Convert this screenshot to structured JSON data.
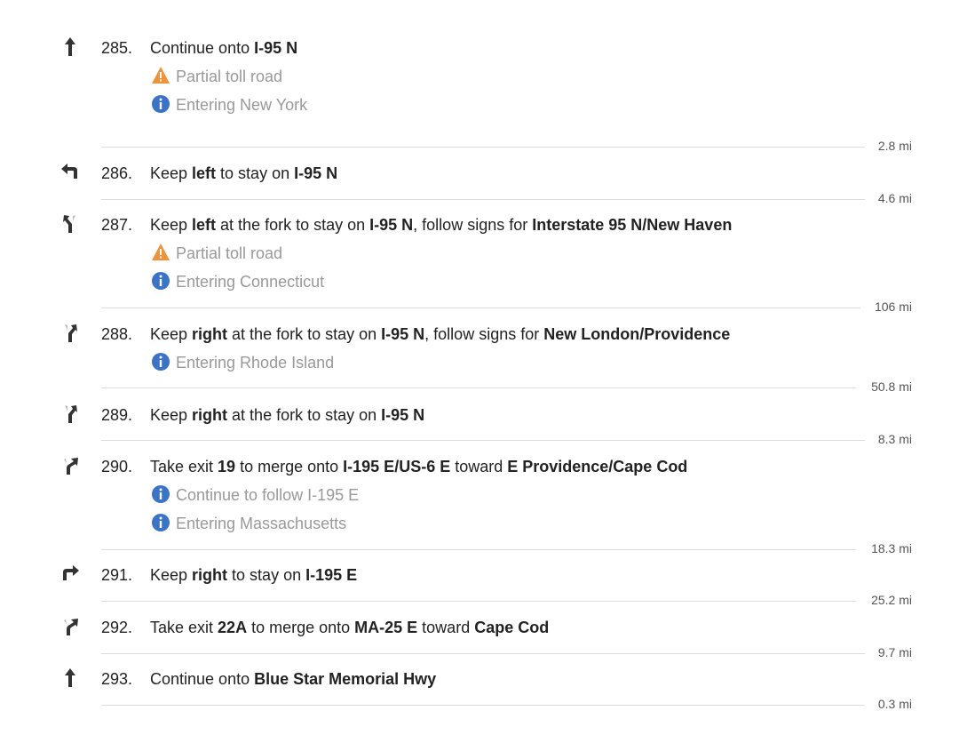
{
  "steps": [
    {
      "num": "285.",
      "icon": "arrow-straight-icon",
      "parts": [
        [
          "Continue onto ",
          false
        ],
        [
          "I-95 N",
          true
        ]
      ],
      "notes": [
        {
          "type": "warning",
          "text": "Partial toll road"
        },
        {
          "type": "info",
          "text": "Entering New York"
        }
      ],
      "distance": "2.8 mi"
    },
    {
      "num": "286.",
      "icon": "keep-left-icon",
      "parts": [
        [
          "Keep ",
          false
        ],
        [
          "left",
          true
        ],
        [
          " to stay on ",
          false
        ],
        [
          "I-95 N",
          true
        ]
      ],
      "notes": [],
      "distance": "4.6 mi"
    },
    {
      "num": "287.",
      "icon": "fork-left-icon",
      "parts": [
        [
          "Keep ",
          false
        ],
        [
          "left",
          true
        ],
        [
          " at the fork to stay on ",
          false
        ],
        [
          "I-95 N",
          true
        ],
        [
          ", follow signs for ",
          false
        ],
        [
          "Interstate 95 N/New Haven",
          true
        ]
      ],
      "notes": [
        {
          "type": "warning",
          "text": "Partial toll road"
        },
        {
          "type": "info",
          "text": "Entering Connecticut"
        }
      ],
      "distance": "106 mi"
    },
    {
      "num": "288.",
      "icon": "fork-right-icon",
      "parts": [
        [
          "Keep ",
          false
        ],
        [
          "right",
          true
        ],
        [
          " at the fork to stay on ",
          false
        ],
        [
          "I-95 N",
          true
        ],
        [
          ", follow signs for ",
          false
        ],
        [
          "New London/Providence",
          true
        ]
      ],
      "notes": [
        {
          "type": "info",
          "text": "Entering Rhode Island"
        }
      ],
      "distance": "50.8 mi"
    },
    {
      "num": "289.",
      "icon": "fork-right-icon",
      "parts": [
        [
          "Keep ",
          false
        ],
        [
          "right",
          true
        ],
        [
          " at the fork to stay on ",
          false
        ],
        [
          "I-95 N",
          true
        ]
      ],
      "notes": [],
      "distance": "8.3 mi"
    },
    {
      "num": "290.",
      "icon": "ramp-right-icon",
      "parts": [
        [
          "Take exit ",
          false
        ],
        [
          "19",
          true
        ],
        [
          " to merge onto ",
          false
        ],
        [
          "I-195 E/US-6 E",
          true
        ],
        [
          " toward ",
          false
        ],
        [
          "E Providence/Cape Cod",
          true
        ]
      ],
      "notes": [
        {
          "type": "info",
          "text": "Continue to follow I-195 E"
        },
        {
          "type": "info",
          "text": "Entering Massachusetts"
        }
      ],
      "distance": "18.3 mi"
    },
    {
      "num": "291.",
      "icon": "keep-right-icon",
      "parts": [
        [
          "Keep ",
          false
        ],
        [
          "right",
          true
        ],
        [
          " to stay on ",
          false
        ],
        [
          "I-195 E",
          true
        ]
      ],
      "notes": [],
      "distance": "25.2 mi"
    },
    {
      "num": "292.",
      "icon": "ramp-right-icon",
      "parts": [
        [
          "Take exit ",
          false
        ],
        [
          "22A",
          true
        ],
        [
          " to merge onto ",
          false
        ],
        [
          "MA-25 E",
          true
        ],
        [
          " toward ",
          false
        ],
        [
          "Cape Cod",
          true
        ]
      ],
      "notes": [],
      "distance": "9.7 mi"
    },
    {
      "num": "293.",
      "icon": "arrow-straight-icon",
      "parts": [
        [
          "Continue onto ",
          false
        ],
        [
          "Blue Star Memorial Hwy",
          true
        ]
      ],
      "notes": [],
      "distance": "0.3 mi"
    }
  ],
  "colors": {
    "warning": "#f0923a",
    "info": "#3a73c8",
    "divider": "#dddddd",
    "note_text": "#999999"
  }
}
